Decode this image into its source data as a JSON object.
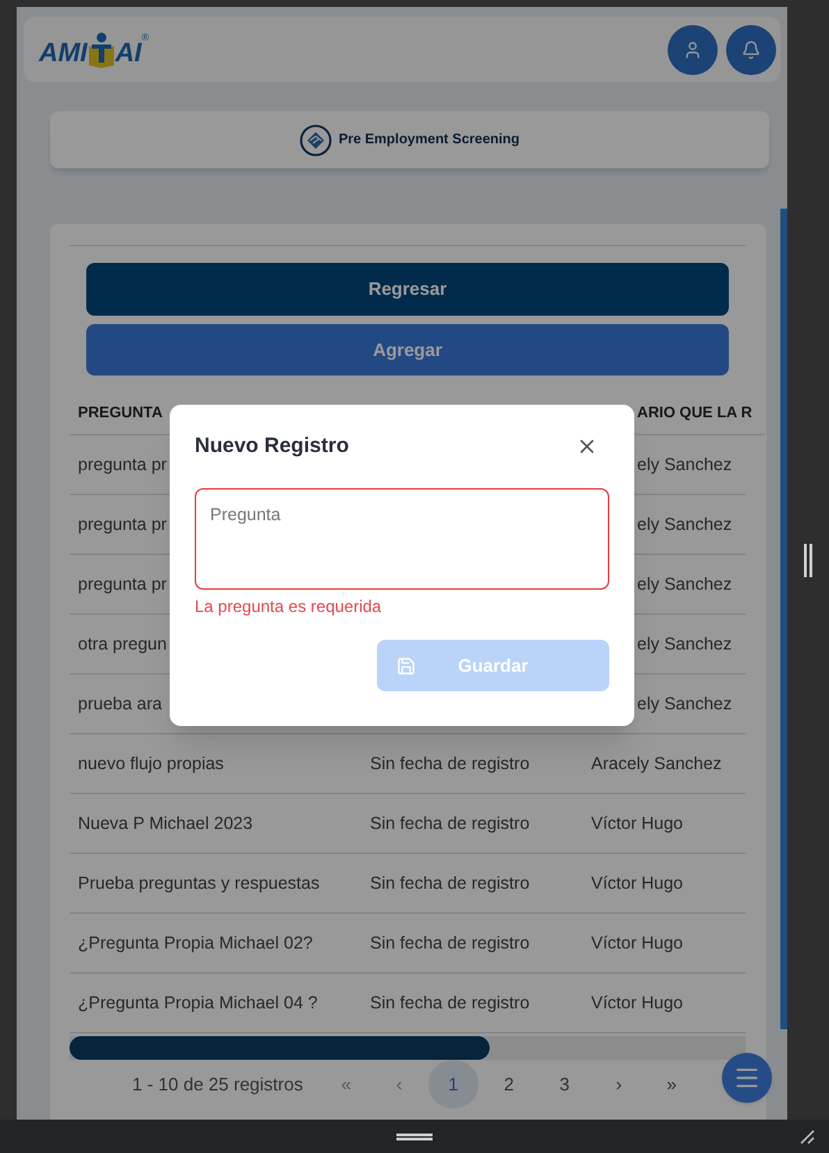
{
  "header": {
    "logo": {
      "left": "AMI",
      "right": "AI",
      "registered": "®"
    }
  },
  "module": {
    "title": "Pre Employment Screening"
  },
  "actions": [
    {
      "label": "Regresar",
      "kind": "primary"
    },
    {
      "label": "Agregar",
      "kind": "secondary"
    }
  ],
  "table": {
    "header": {
      "column_1": "PREGUNTA",
      "column_3": "ARIO QUE LA R"
    },
    "rows": [
      {
        "kind": "covered",
        "column_1": "pregunta pr",
        "column_3": "ely Sanchez"
      },
      {
        "kind": "covered",
        "column_1": "pregunta pr",
        "column_3": "ely Sanchez"
      },
      {
        "kind": "covered",
        "column_1": "pregunta pr",
        "column_3": "ely Sanchez"
      },
      {
        "kind": "covered",
        "column_1": "otra pregun",
        "column_3": "ely Sanchez"
      },
      {
        "kind": "covered",
        "column_1": "prueba ara",
        "column_3": "ely Sanchez"
      },
      {
        "kind": "full",
        "column_1": "nuevo flujo propias",
        "column_2": "Sin fecha de registro",
        "column_3": "Aracely Sanchez"
      },
      {
        "kind": "full",
        "column_1": "Nueva P Michael 2023",
        "column_2": "Sin fecha de registro",
        "column_3": "Víctor Hugo"
      },
      {
        "kind": "full",
        "column_1": "Prueba preguntas y respuestas",
        "column_2": "Sin fecha de registro",
        "column_3": "Víctor Hugo"
      },
      {
        "kind": "full",
        "column_1": "¿Pregunta Propia Michael 02?",
        "column_2": "Sin fecha de registro",
        "column_3": "Víctor Hugo"
      },
      {
        "kind": "full",
        "column_1": "¿Pregunta Propia Michael 04 ?",
        "column_2": "Sin fecha de registro",
        "column_3": "Víctor Hugo"
      }
    ]
  },
  "pagination": {
    "summary": "1 - 10 de 25 registros",
    "first": "«",
    "prev": "‹",
    "pages": [
      {
        "label": "1",
        "selected": true
      },
      {
        "label": "2",
        "selected": false
      },
      {
        "label": "3",
        "selected": false
      }
    ],
    "next": "›",
    "last": "»"
  },
  "modal": {
    "title": "Nuevo Registro",
    "field": {
      "placeholder": "Pregunta",
      "invalid": true
    },
    "error": "La pregunta es requerida",
    "save": {
      "label": "Guardar",
      "disabled": true
    }
  }
}
